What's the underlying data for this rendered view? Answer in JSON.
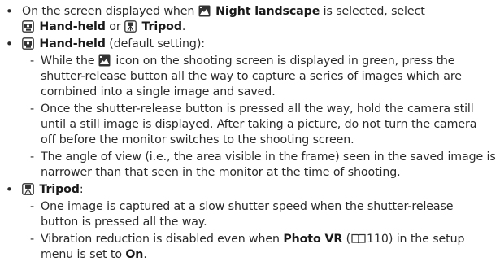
{
  "bullet_glyph": "•",
  "dash_glyph": "-",
  "paren_open": "(",
  "paren_close": ")",
  "intro": {
    "t1": "On the screen displayed when",
    "night_landscape": "Night landscape",
    "t2": "is selected, select",
    "hand_held": "Hand-held",
    "or": "or",
    "tripod": "Tripod",
    "end": "."
  },
  "handheld_head": {
    "label": "Hand-held",
    "note": "(default setting):"
  },
  "handheld_items": [
    {
      "l1a": "While the",
      "l1b": "icon on the shooting screen is displayed in green, press the",
      "l2": "shutter-release button all the way to capture a series of images which are",
      "l3": "combined into a single image and saved."
    },
    {
      "l1": "Once the shutter-release button is pressed all the way, hold the camera still",
      "l2": "until a still image is displayed. After taking a picture, do not turn the camera",
      "l3": "off before the monitor switches to the shooting screen."
    },
    {
      "l1": "The angle of view (i.e., the area visible in the frame) seen in the saved image is",
      "l2": "narrower than that seen in the monitor at the time of shooting."
    }
  ],
  "tripod_head": {
    "label": "Tripod",
    "colon": ":"
  },
  "tripod_items": [
    {
      "l1": "One image is captured at a slow shutter speed when the shutter-release",
      "l2": "button is pressed all the way."
    },
    {
      "l1a": "Vibration reduction is disabled even when",
      "photo_vr": "Photo VR",
      "page_ref": "110",
      "l1c": "in the setup",
      "l2a": "menu is set to",
      "on": "On",
      "end": "."
    }
  ],
  "icons": {
    "night": "night-landscape-icon",
    "handheld": "hand-held-icon",
    "tripod": "tripod-icon",
    "book": "reference-book-icon"
  },
  "colors": {
    "text": "#2a2a2a",
    "icon": "#333333"
  }
}
